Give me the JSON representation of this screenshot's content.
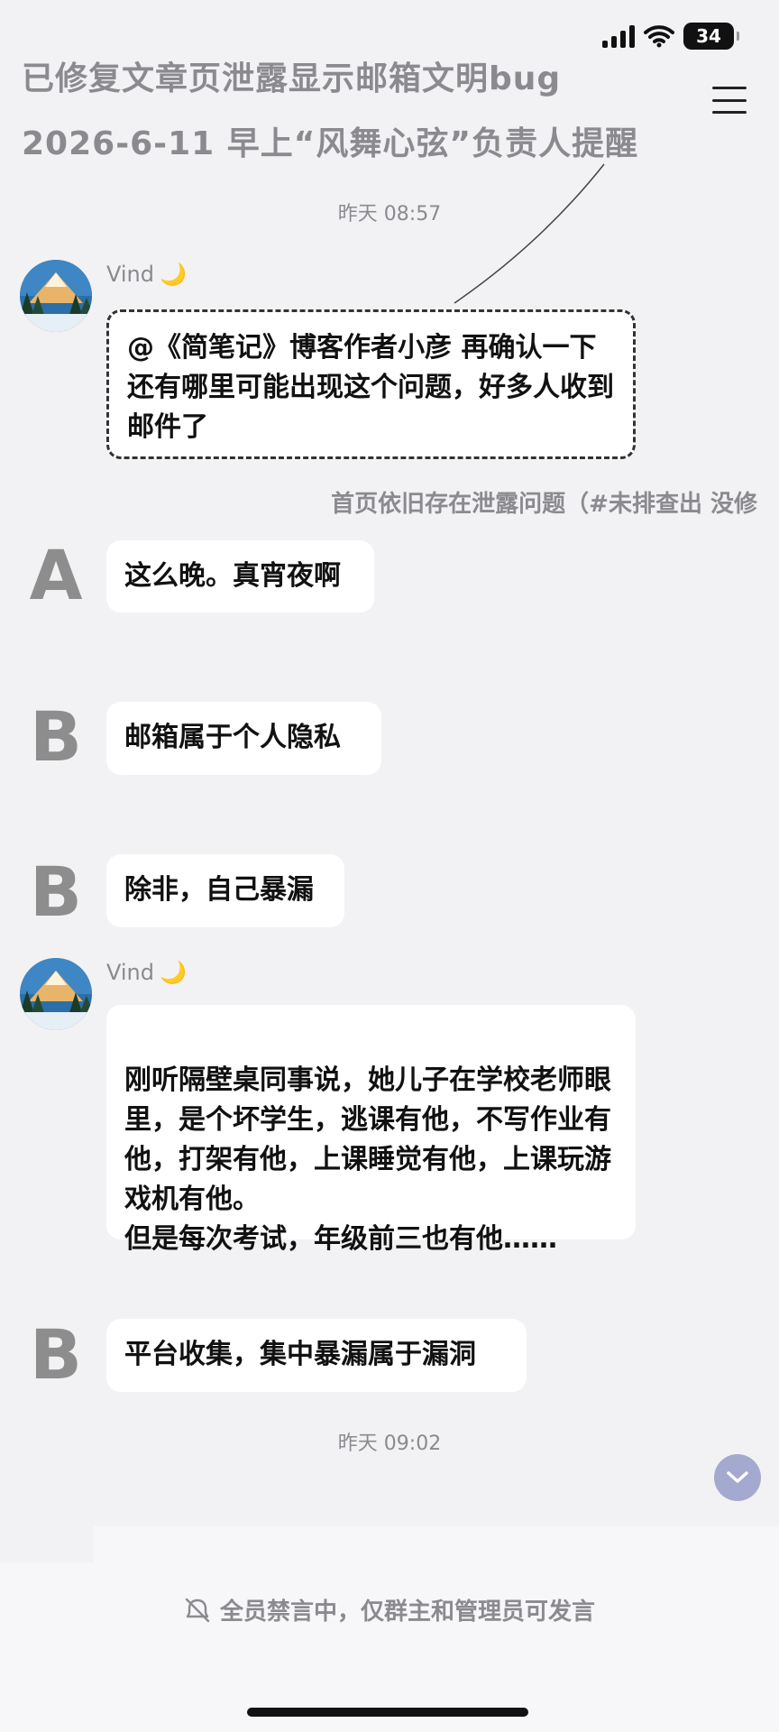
{
  "status_bar": {
    "battery": "34"
  },
  "header": {
    "title_line1": "已修复文章页泄露显示邮箱文明bug",
    "title_line2": "2026-6-11 早上“风舞心弦”负责人提醒"
  },
  "messages": {
    "time1": "昨天 08:57",
    "msg1": {
      "sender": "Vind",
      "emoji": "🌙",
      "text": "@《简笔记》博客作者小彦 再确认一下还有哪里可能出现这个问题，好多人收到邮件了"
    },
    "annotation": "首页依旧存在泄露问题（#未排查出 没修",
    "msg2": {
      "avatar_letter": "A",
      "text": "这么晚。真宵夜啊"
    },
    "msg3": {
      "avatar_letter": "B",
      "text": "邮箱属于个人隐私"
    },
    "msg4": {
      "avatar_letter": "B",
      "text": "除非，自己暴漏"
    },
    "msg5": {
      "sender": "Vind",
      "emoji": "🌙",
      "text": "刚听隔壁桌同事说，她儿子在学校老师眼里，是个坏学生，逃课有他，不写作业有他，打架有他，上课睡觉有他，上课玩游戏机有他。\n但是每次考试，年级前三也有他……"
    },
    "msg6": {
      "avatar_letter": "B",
      "text": "平台收集，集中暴漏属于漏洞"
    },
    "time2": "昨天 09:02"
  },
  "footer": {
    "mute_notice": "全员禁言中，仅群主和管理员可发言"
  },
  "icons": {
    "signal": "signal-icon",
    "wifi": "wifi-icon",
    "battery": "battery-icon",
    "menu": "menu-icon",
    "scroll_down": "chevron-down-icon",
    "mute": "mute-icon"
  },
  "colors": {
    "background": "#f2f2f5",
    "bubble": "#ffffff",
    "muted_text": "#8a8a8f",
    "scroll_button": "#a4a9cf"
  }
}
